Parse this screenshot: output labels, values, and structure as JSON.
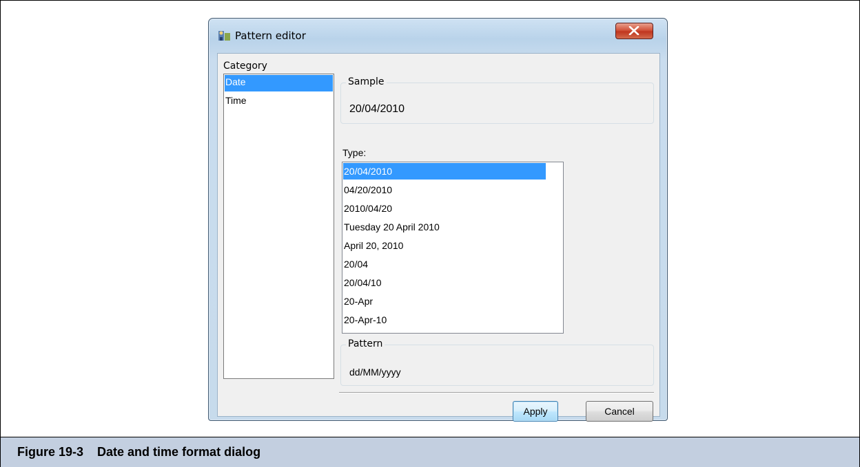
{
  "window": {
    "title": "Pattern editor",
    "close_label": "x"
  },
  "category": {
    "label": "Category",
    "items": [
      {
        "label": "Date",
        "selected": true
      },
      {
        "label": "Time",
        "selected": false
      }
    ]
  },
  "sample": {
    "title": "Sample",
    "value": "20/04/2010"
  },
  "type": {
    "label": "Type:",
    "items": [
      {
        "label": "20/04/2010",
        "selected": true
      },
      {
        "label": "04/20/2010",
        "selected": false
      },
      {
        "label": "2010/04/20",
        "selected": false
      },
      {
        "label": "Tuesday 20 April 2010",
        "selected": false
      },
      {
        "label": "April 20, 2010",
        "selected": false
      },
      {
        "label": "20/04",
        "selected": false
      },
      {
        "label": "20/04/10",
        "selected": false
      },
      {
        "label": "20-Apr",
        "selected": false
      },
      {
        "label": "20-Apr-10",
        "selected": false
      }
    ]
  },
  "pattern": {
    "title": "Pattern",
    "value": "dd/MM/yyyy"
  },
  "buttons": {
    "apply": "Apply",
    "cancel": "Cancel"
  },
  "caption": {
    "text": "Figure 19-3    Date and time format dialog"
  },
  "colors": {
    "selection": "#3399ff",
    "caption_bar": "#c3cfe0",
    "close_button": "#c0361f"
  }
}
